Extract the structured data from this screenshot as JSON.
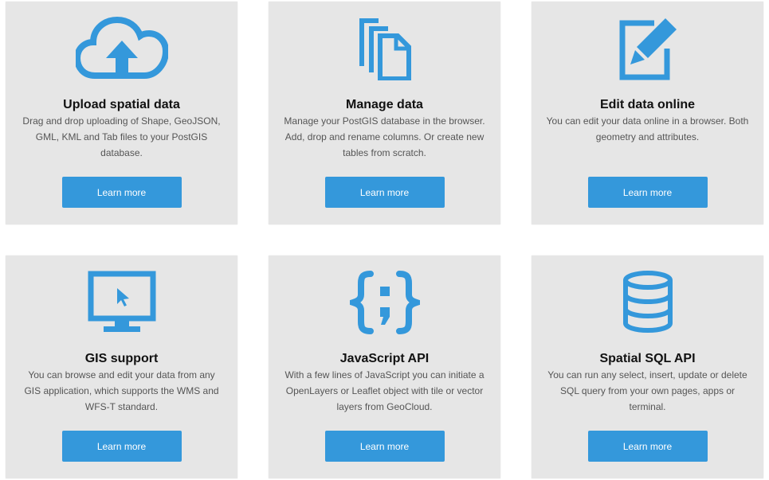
{
  "colors": {
    "accent": "#3498db",
    "card_background": "#e6e6e6",
    "title_text": "#111111",
    "body_text": "#555555"
  },
  "cards": [
    {
      "icon": "cloud-upload-icon",
      "title": "Upload spatial data",
      "desc": "Drag and drop uploading of Shape, GeoJSON, GML, KML and Tab files to your PostGIS database.",
      "button": "Learn more"
    },
    {
      "icon": "files-icon",
      "title": "Manage data",
      "desc": "Manage your PostGIS database in the browser. Add, drop and rename columns. Or create new tables from scratch.",
      "button": "Learn more"
    },
    {
      "icon": "edit-icon",
      "title": "Edit data online",
      "desc": "You can edit your data online in a browser. Both geometry and attributes.",
      "button": "Learn more"
    },
    {
      "icon": "monitor-icon",
      "title": "GIS support",
      "desc": "You can browse and edit your data from any GIS application, which supports the WMS and WFS-T standard.",
      "button": "Learn more"
    },
    {
      "icon": "code-braces-icon",
      "title": "JavaScript API",
      "desc": "With a few lines of JavaScript you can initiate a OpenLayers or Leaflet object with tile or vector layers from GeoCloud.",
      "button": "Learn more"
    },
    {
      "icon": "database-icon",
      "title": "Spatial SQL API",
      "desc": "You can run any select, insert, update or delete SQL query from your own pages, apps or terminal.",
      "button": "Learn more"
    }
  ]
}
